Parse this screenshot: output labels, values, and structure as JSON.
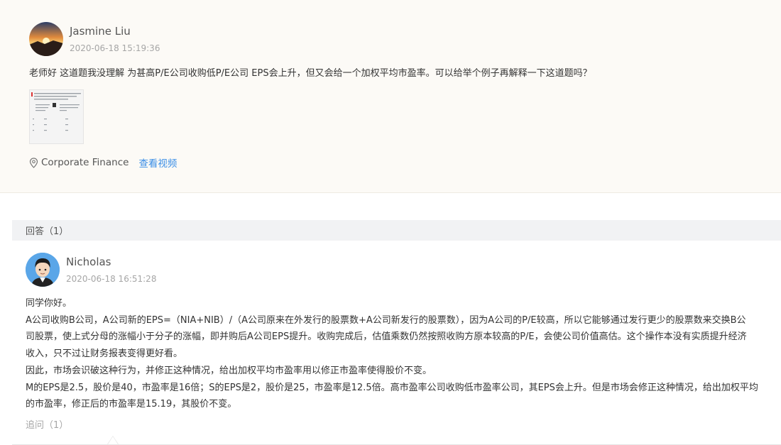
{
  "question": {
    "author": "Jasmine Liu",
    "timestamp": "2020-06-18 15:19:36",
    "text": "老师好 这道题我没理解 为甚高P/E公司收购低P/E公司 EPS会上升，但又会给一个加权平均市盈率。可以给举个例子再解释一下这道题吗？",
    "tag": "Corporate Finance",
    "video_link": "查看视频",
    "tag_icon": "location-pin-icon"
  },
  "answers_header": "回答（1）",
  "answer": {
    "author": "Nicholas",
    "timestamp": "2020-06-18 16:51:28",
    "lines": [
      "同学你好。",
      "A公司收购B公司，A公司新的EPS=（NIA+NIB）/（A公司原来在外发行的股票数+A公司新发行的股票数），因为A公司的P/E较高，所以它能够通过发行更少的股票数来交换B公",
      "司股票，使上式分母的涨幅小于分子的涨幅，即并购后A公司EPS提升。收购完成后，估值乘数仍然按照收购方原本较高的P/E，会使公司价值高估。这个操作本没有实质提升经济",
      "收入，只不过让财务报表变得更好看。",
      "因此，市场会识破这种行为，并修正这种情况，给出加权平均市盈率用以修正市盈率使得股价不变。",
      "M的EPS是2.5，股价是40，市盈率是16倍；S的EPS是2，股价是25，市盈率是12.5倍。高市盈率公司收购低市盈率公司，其EPS会上升。但是市场会修正这种情况，给出加权平均",
      "的市盈率，修正后的市盈率是15.19，其股价不变。"
    ],
    "followup": "追问（1）"
  },
  "colors": {
    "link": "#3a8ee6",
    "question_bg": "#fcfaf6",
    "bar_bg": "#f1f2f4"
  }
}
